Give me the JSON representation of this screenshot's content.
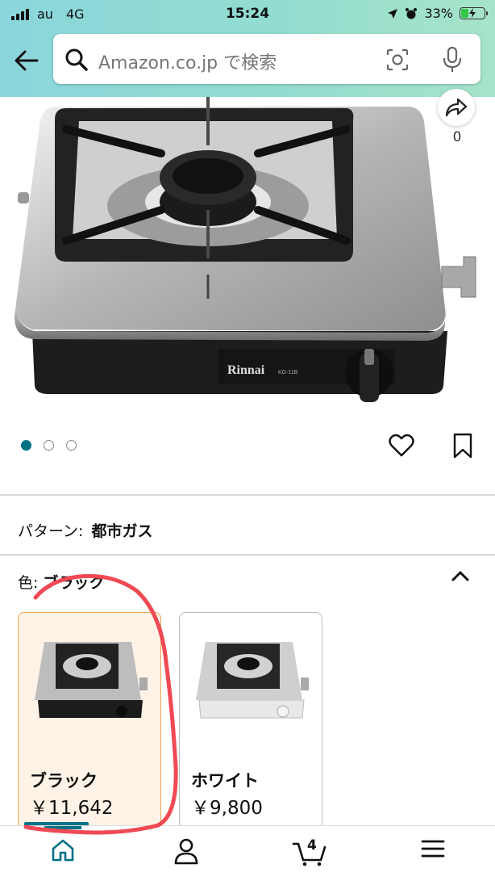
{
  "status_bar": {
    "carrier": "au",
    "network": "4G",
    "time": "15:24",
    "battery_percent": "33%",
    "battery_level": 0.33
  },
  "search": {
    "placeholder": "Amazon.co.jp で検索"
  },
  "product": {
    "brand_label": "Rinnai",
    "model_label": "KG-11B",
    "share_count": "0",
    "image_count": 3,
    "active_image": 1
  },
  "pattern": {
    "label": "パターン:",
    "value": "都市ガス"
  },
  "color": {
    "label": "色:",
    "value": "ブラック",
    "options": [
      {
        "name": "ブラック",
        "price": "￥11,642",
        "selected": true
      },
      {
        "name": "ホワイト",
        "price": "￥9,800",
        "selected": false
      }
    ]
  },
  "bottom_nav": {
    "cart_count": "4"
  },
  "colors": {
    "accent": "#007185",
    "header_gradient_start": "#8ad6dc",
    "header_gradient_end": "#a6e4c9",
    "selected_swatch_bg": "#fef3e6",
    "selected_swatch_border": "#e7a352",
    "annotation_red": "#ef4a54"
  }
}
